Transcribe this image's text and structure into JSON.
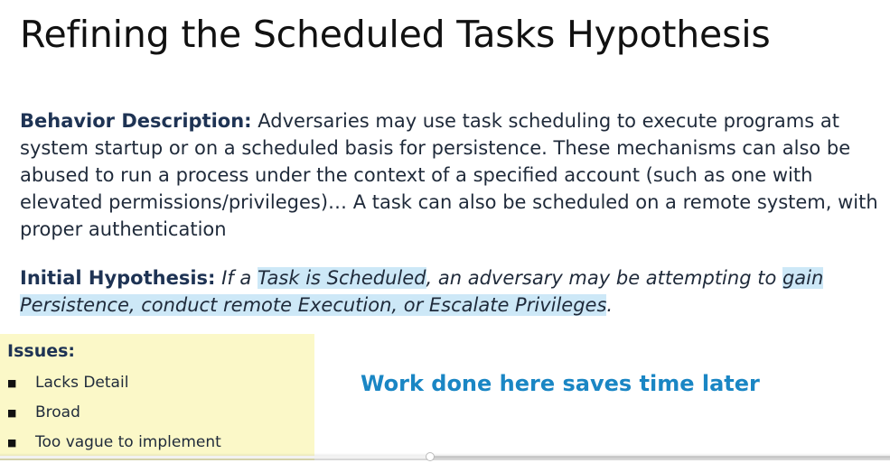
{
  "slide": {
    "title": "Refining the Scheduled Tasks Hypothesis",
    "behavior": {
      "label": "Behavior Description:",
      "text": " Adversaries may use task scheduling to execute programs at system startup or on a scheduled basis for persistence. These mechanisms can also be abused to run a process under the context of a specified account (such as one with elevated permissions/privileges)…  A task can also be scheduled on a remote system, with proper authentication"
    },
    "hypothesis": {
      "label": "Initial Hypothesis:",
      "part1": "If a ",
      "highlight1": "Task is Scheduled",
      "part2": ", an adversary may be attempting to ",
      "highlight2": "gain Persistence, conduct remote Execution, or Escalate Privileges",
      "part3": "."
    },
    "issues": {
      "heading": "Issues:",
      "items": [
        "Lacks Detail",
        "Broad",
        "Too vague to implement"
      ]
    },
    "callout": "Work done here saves time later"
  },
  "player": {
    "progress_percent": 48.3
  },
  "colors": {
    "highlight": "#cde8f7",
    "issues_bg": "#fbf8c8",
    "callout": "#1a86c4",
    "label": "#1e3354"
  }
}
